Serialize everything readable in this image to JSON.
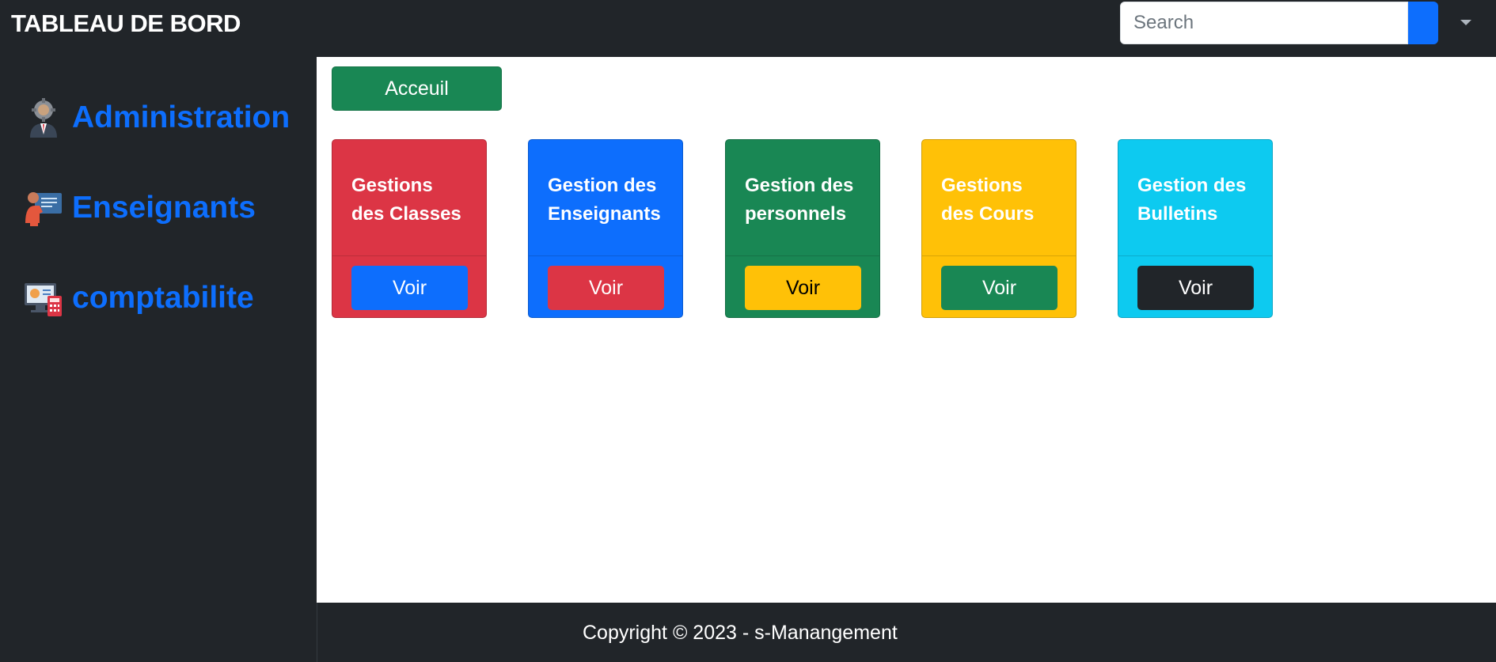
{
  "navbar": {
    "brand": "TABLEAU DE BORD",
    "search_placeholder": "Search"
  },
  "sidebar": {
    "items": [
      {
        "label": "Administration",
        "icon": "admin-gear-person-icon"
      },
      {
        "label": "Enseignants",
        "icon": "teacher-board-icon"
      },
      {
        "label": "comptabilite",
        "icon": "computer-calculator-icon"
      }
    ]
  },
  "main": {
    "home_button": "Acceuil",
    "cards": [
      {
        "title_line1": "Gestions",
        "title_line2": "des Classes",
        "button": "Voir",
        "card_color": "#dc3545",
        "button_color": "#0d6efd",
        "button_text_color": "#ffffff"
      },
      {
        "title_line1": "Gestion des",
        "title_line2": "Enseignants",
        "button": "Voir",
        "card_color": "#0d6efd",
        "button_color": "#dc3545",
        "button_text_color": "#ffffff"
      },
      {
        "title_line1": "Gestion des",
        "title_line2": "personnels",
        "button": "Voir",
        "card_color": "#198754",
        "button_color": "#ffc107",
        "button_text_color": "#000000"
      },
      {
        "title_line1": "Gestions",
        "title_line2": "des Cours",
        "button": "Voir",
        "card_color": "#ffc107",
        "button_color": "#198754",
        "button_text_color": "#ffffff"
      },
      {
        "title_line1": "Gestion des",
        "title_line2": "Bulletins",
        "button": "Voir",
        "card_color": "#0dcaf0",
        "button_color": "#212529",
        "button_text_color": "#ffffff"
      }
    ]
  },
  "footer": {
    "copyright": "Copyright © 2023 - s-Manangement"
  },
  "colors": {
    "dark": "#212529",
    "primary": "#0d6efd",
    "success": "#198754",
    "danger": "#dc3545",
    "warning": "#ffc107",
    "info": "#0dcaf0"
  }
}
